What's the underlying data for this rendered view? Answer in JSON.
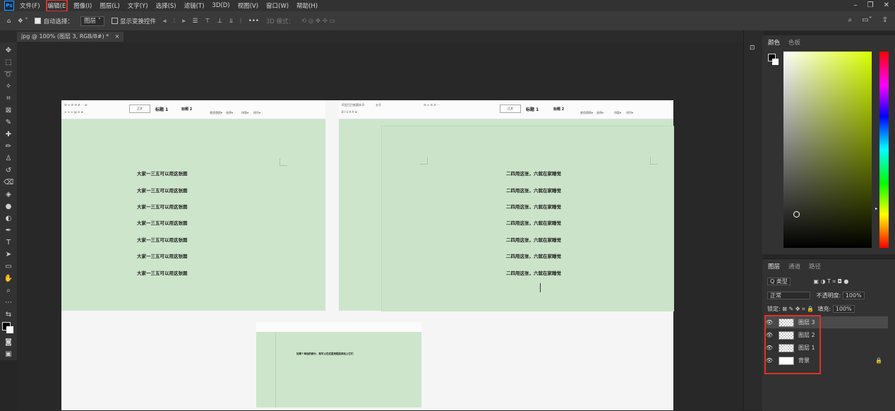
{
  "menu": {
    "ps_logo": "Ps",
    "items": [
      "文件(F)",
      "编辑(E",
      "图像(I)",
      "图层(L)",
      "文字(Y)",
      "选择(S)",
      "滤镜(T)",
      "3D(D)",
      "视图(V)",
      "窗口(W)",
      "帮助(H)"
    ]
  },
  "options": {
    "auto_select": "自动选择：",
    "auto_select_value": "图层",
    "show_transform": "显示变换控件",
    "more": "•••",
    "mode_3d": "3D 模式："
  },
  "tab": {
    "title": "jpg @ 100% (图层 3, RGB/8#) *",
    "close": "×"
  },
  "document": {
    "left_page": {
      "style_normal": "正文",
      "style_h1": "标题 1",
      "style_h2": "标题 2",
      "ribbon_find": "查找替换▾",
      "ribbon_select": "选择▾",
      "ribbon_sort": "排版▾",
      "ribbon_arrange": "排列▾",
      "lines": [
        "大家一三五可以用这张图",
        "大家一三五可以用这张图",
        "大家一三五可以用这张图",
        "大家一三五可以用这张图",
        "大家一三五可以用这张图",
        "大家一三五可以用这张图",
        "大家一三五可以用这张图"
      ]
    },
    "right_page": {
      "font": "阿里巴巴普惠体 B",
      "size": "五号",
      "style_normal": "正文",
      "style_h1": "标题 1",
      "style_h2": "标题 2",
      "ribbon_find": "查找替换▾",
      "ribbon_select": "选择▾",
      "ribbon_sort": "排版▾",
      "ribbon_arrange": "排列▾",
      "lines": [
        "二四用这张，六就在家睡觉",
        "二四用这张，六就在家睡觉",
        "二四用这张，六就在家睡觉",
        "二四用这张，六就在家睡觉",
        "二四用这张，六就在家睡觉",
        "二四用这张，六就在家睡觉",
        "二四用这张，六就在家睡觉"
      ]
    },
    "bottom_page": {
      "line": "如果个单独的部分，就可以在这里用图层添加上它们"
    }
  },
  "color_panel": {
    "tabs": [
      "颜色",
      "色板"
    ],
    "fg_color": "#000000",
    "bg_color": "#ffffff",
    "hue_base": "#d8ff00"
  },
  "layers_panel": {
    "tabs": [
      "图层",
      "通道",
      "路径"
    ],
    "filter_label": "Q 类型",
    "blend_mode": "正常",
    "opacity_label": "不透明度:",
    "opacity_value": "100%",
    "lock_label": "锁定:",
    "fill_label": "填充:",
    "fill_value": "100%",
    "layers": [
      {
        "name": "图层 3",
        "selected": true
      },
      {
        "name": "图层 2",
        "selected": false
      },
      {
        "name": "图层 1",
        "selected": false
      },
      {
        "name": "背景",
        "selected": false
      }
    ]
  },
  "highlight_color": "#e0312b"
}
